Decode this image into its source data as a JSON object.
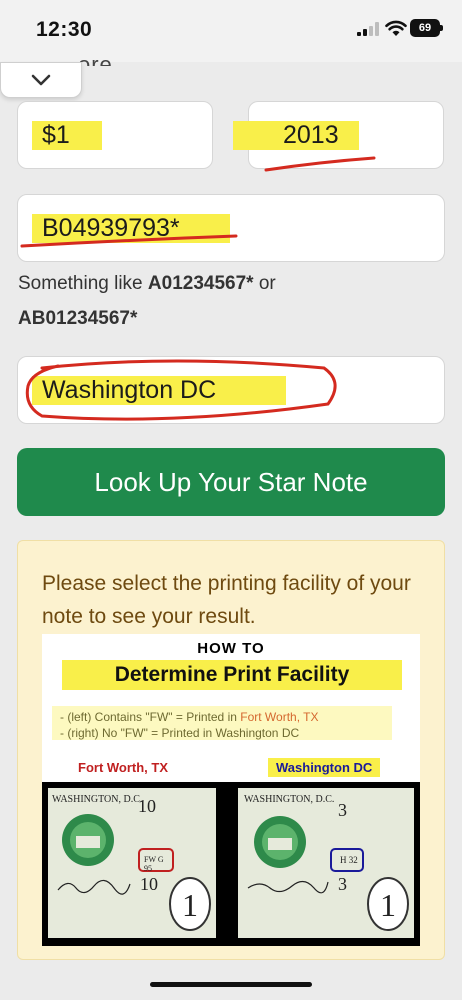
{
  "status": {
    "time": "12:30",
    "battery": "69"
  },
  "form": {
    "cut_heading": "ore.",
    "denomination": "$1",
    "year": "2013",
    "serial": "B04939793*",
    "hint_prefix": "Something like ",
    "hint_example1": "A01234567*",
    "hint_or": " or",
    "hint_example2": "AB01234567*",
    "facility": "Washington DC",
    "lookup_label": "Look Up Your Star Note"
  },
  "info": {
    "message": "Please select the printing facility of your note to see your result."
  },
  "guide": {
    "title": "HOW TO",
    "subtitle": "Determine Print Facility",
    "line1_prefix": "- (left) Contains \"FW\" = Printed in ",
    "line1_city": "Fort Worth, TX",
    "line2": "- (right) No \"FW\" = Printed in Washington DC",
    "label_left": "Fort Worth, TX",
    "label_right": "Washington DC",
    "bill_left_header": "WASHINGTON, D.C.",
    "bill_left_number": "10",
    "bill_left_number2": "10",
    "bill_left_mark": "FW G 95",
    "bill_right_header": "WASHINGTON, D.C.",
    "bill_right_number": "3",
    "bill_right_number2": "3",
    "bill_right_mark": "H 32",
    "bill_value": "1"
  },
  "colors": {
    "accent_green": "#1f8a4c",
    "highlight": "#f9ef4a",
    "panel_bg": "#fcf2cf",
    "panel_text": "#6e4a10",
    "fw_red": "#c02020",
    "dc_blue": "#1a1a9a",
    "annotation_red": "#d42a1f"
  }
}
